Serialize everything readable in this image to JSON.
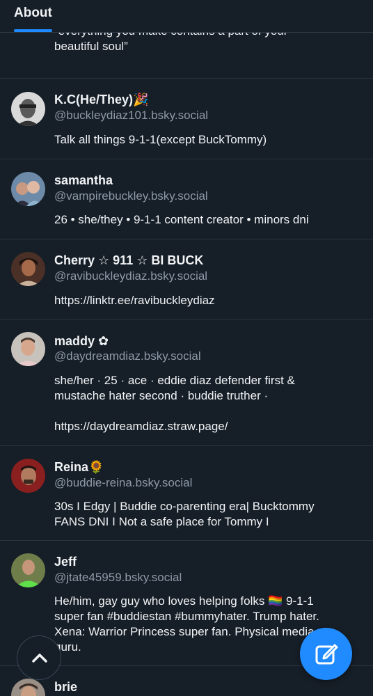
{
  "header": {
    "tab_about": "About"
  },
  "partial_description": {
    "line1": "“everything you make contains a part of your",
    "line2": "beautiful soul”"
  },
  "items": [
    {
      "name": "K.C(He/They)🎉",
      "handle": "@buckleydiaz101.bsky.social",
      "description": "Talk all things 9-1-1(except BuckTommy)"
    },
    {
      "name": "samantha",
      "handle": "@vampirebuckley.bsky.social",
      "description": "26 • she/they • 9-1-1 content creator • minors dni"
    },
    {
      "name": "Cherry ☆ 911 ☆ BI BUCK",
      "handle": "@ravibuckleydiaz.bsky.social",
      "description": "https://linktr.ee/ravibuckleydiaz"
    },
    {
      "name": "maddy ✿",
      "handle": "@daydreamdiaz.bsky.social",
      "description": "she/her · 25 · ace · eddie diaz defender first &\nmustache hater second · buddie truther ·\n\nhttps://daydreamdiaz.straw.page/"
    },
    {
      "name": "Reina🌻",
      "handle": "@buddie-reina.bsky.social",
      "description": "30s I Edgy | Buddie co-parenting era| Bucktommy\nFANS DNI I Not a safe place for Tommy I"
    },
    {
      "name": "Jeff",
      "handle": "@jtate45959.bsky.social",
      "description": "He/him, gay guy who loves helping folks 🏳️‍🌈 9-1-1\nsuper fan #buddiestan #bummyhater.  Trump hater.\nXena: Warrior Princess super fan.  Physical media\nguru."
    },
    {
      "name": "brie",
      "handle": "",
      "description": ""
    }
  ],
  "icons": {
    "scroll_top": "chevron-up-icon",
    "compose": "compose-icon"
  },
  "colors": {
    "accent": "#208bfe",
    "background": "#161e27",
    "muted": "#8e9aa8"
  }
}
